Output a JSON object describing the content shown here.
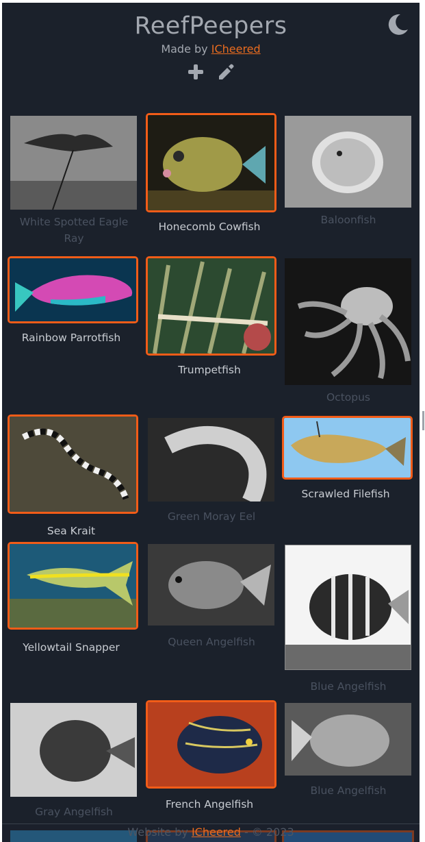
{
  "header": {
    "title": "ReefPeepers",
    "made_by_prefix": "Made by ",
    "author": "ICheered",
    "add_icon": "plus-icon",
    "edit_icon": "pencil-icon",
    "theme_icon": "moon-icon"
  },
  "colors": {
    "background": "#1b212b",
    "accent": "#f25c18",
    "link": "#ea6c1f",
    "caption_active": "#c8ccd2",
    "caption_dim": "#4a5260"
  },
  "cards": [
    {
      "name": "White Spotted Eagle Ray",
      "highlighted": false
    },
    {
      "name": "Honecomb Cowfish",
      "highlighted": true
    },
    {
      "name": "Baloonfish",
      "highlighted": false
    },
    {
      "name": "Rainbow Parrotfish",
      "highlighted": true
    },
    {
      "name": "Trumpetfish",
      "highlighted": true
    },
    {
      "name": "Octopus",
      "highlighted": false
    },
    {
      "name": "Sea Krait",
      "highlighted": true
    },
    {
      "name": "Green Moray Eel",
      "highlighted": false
    },
    {
      "name": "Scrawled Filefish",
      "highlighted": true
    },
    {
      "name": "Yellowtail Snapper",
      "highlighted": true
    },
    {
      "name": "Queen Angelfish",
      "highlighted": false
    },
    {
      "name": "Blue Angelfish",
      "highlighted": false
    },
    {
      "name": "Gray Angelfish",
      "highlighted": false
    },
    {
      "name": "French Angelfish",
      "highlighted": true
    },
    {
      "name": "Blue Angelfish",
      "highlighted": false
    }
  ],
  "footer": {
    "prefix": "Website by ",
    "author": "ICheered",
    "suffix": " - © 2023"
  }
}
